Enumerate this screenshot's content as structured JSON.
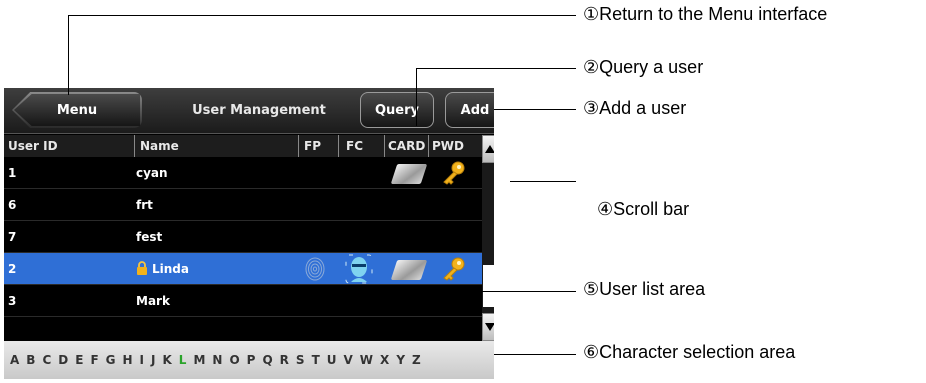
{
  "topbar": {
    "menu_label": "Menu",
    "title": "User Management",
    "query_label": "Query",
    "add_label": "Add"
  },
  "table": {
    "headers": [
      "User ID",
      "Name",
      "FP",
      "FC",
      "CARD",
      "PWD"
    ],
    "rows": [
      {
        "id": "1",
        "name": "cyan",
        "card": true,
        "pwd": true,
        "fp": false,
        "fc": false,
        "selected": false,
        "locked": false
      },
      {
        "id": "6",
        "name": "frt",
        "card": false,
        "pwd": false,
        "fp": false,
        "fc": false,
        "selected": false,
        "locked": false
      },
      {
        "id": "7",
        "name": "fest",
        "card": false,
        "pwd": false,
        "fp": false,
        "fc": false,
        "selected": false,
        "locked": false
      },
      {
        "id": "2",
        "name": "Linda",
        "card": true,
        "pwd": true,
        "fp": true,
        "fc": true,
        "selected": true,
        "locked": true
      },
      {
        "id": "3",
        "name": "Mark",
        "card": false,
        "pwd": false,
        "fp": false,
        "fc": false,
        "selected": false,
        "locked": false
      }
    ]
  },
  "char_bar": {
    "letters": [
      "A",
      "B",
      "C",
      "D",
      "E",
      "F",
      "G",
      "H",
      "I",
      "J",
      "K",
      "L",
      "M",
      "N",
      "O",
      "P",
      "Q",
      "R",
      "S",
      "T",
      "U",
      "V",
      "W",
      "X",
      "Y",
      "Z"
    ],
    "highlighted": "L",
    "highlight_color": "#2aa32a"
  },
  "callouts": {
    "c1": "①Return to the Menu interface",
    "c2": "②Query a user",
    "c3": "③Add a user",
    "c4": "④Scroll bar",
    "c5": "⑤User list area",
    "c6": "⑥Character selection area"
  },
  "colors": {
    "selected_row": "#2f6fd6",
    "key": "#f2b21c"
  }
}
